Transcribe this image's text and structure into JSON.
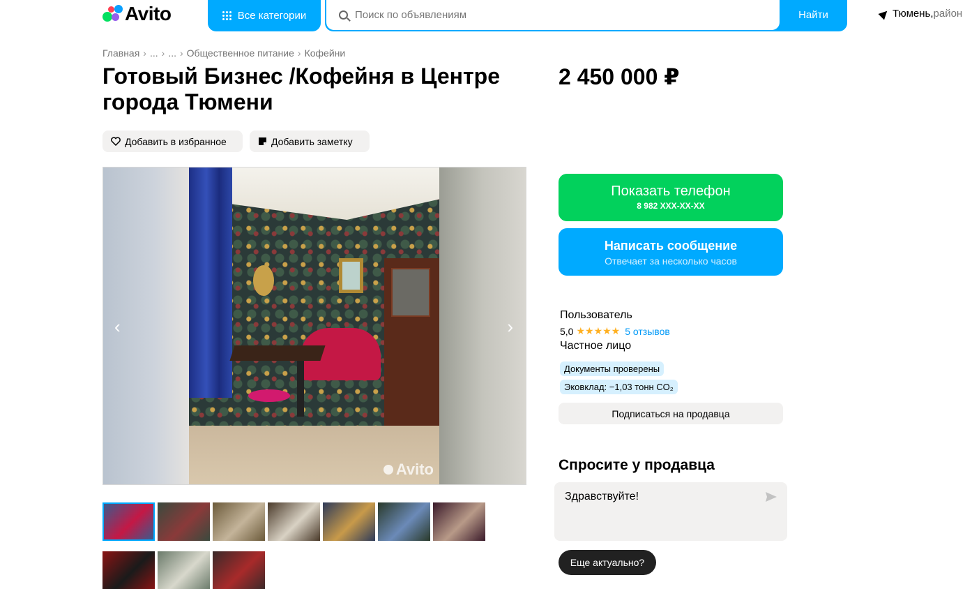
{
  "header": {
    "logo_text": "Avito",
    "categories_label": "Все категории",
    "search_placeholder": "Поиск по объявлениям",
    "search_button": "Найти",
    "location_city": "Тюмень,",
    "location_district": " район"
  },
  "breadcrumb": [
    "Главная",
    "...",
    "...",
    "Общественное питание",
    "Кофейни"
  ],
  "listing": {
    "title": "Готовый Бизнес /Кофейня в Центре города Тюмени",
    "price": "2 450 000 ₽",
    "favorite_label": "Добавить в избранное",
    "note_label": "Добавить заметку",
    "photo_watermark": "Avito",
    "nav_prev": "‹",
    "nav_next": "›"
  },
  "thumbnails": [
    {
      "name": "thumb-1",
      "colors": [
        "#3c5a8c",
        "#c41845"
      ]
    },
    {
      "name": "thumb-2",
      "colors": [
        "#3a4a3e",
        "#8a3a3a"
      ]
    },
    {
      "name": "thumb-3",
      "colors": [
        "#6b5a3a",
        "#c4b49a"
      ]
    },
    {
      "name": "thumb-4",
      "colors": [
        "#4a3a2a",
        "#d9d2c4"
      ]
    },
    {
      "name": "thumb-5",
      "colors": [
        "#2e3b5a",
        "#c89a4a"
      ]
    },
    {
      "name": "thumb-6",
      "colors": [
        "#2a3a2a",
        "#6b8ab8"
      ]
    },
    {
      "name": "thumb-7",
      "colors": [
        "#3a1a2a",
        "#b89a88"
      ]
    },
    {
      "name": "thumb-8",
      "colors": [
        "#8a1414",
        "#1a1a1a"
      ]
    },
    {
      "name": "thumb-9",
      "colors": [
        "#6a7a6a",
        "#d8d8cc"
      ]
    },
    {
      "name": "thumb-10",
      "colors": [
        "#3a2a2a",
        "#a82a2a"
      ]
    }
  ],
  "contact": {
    "phone_label": "Показать телефон",
    "phone_masked": "8 982 XXX-XX-XX",
    "message_label": "Написать сообщение",
    "message_sub": "Отвечает за несколько часов"
  },
  "seller": {
    "name": "Пользователь",
    "rating": "5,0",
    "stars": "★★★★★",
    "reviews": "5 отзывов",
    "type": "Частное лицо",
    "badge_docs": "Документы проверены",
    "badge_eco": "Эковклад: −1,03 тонн CO₂",
    "subscribe_label": "Подписаться на продавца"
  },
  "ask": {
    "title": "Спросите у продавца",
    "message_text": "Здравствуйте!",
    "quick_reply": "Еще актуально?"
  },
  "colors": {
    "brand_blue": "#00aaff",
    "brand_green": "#02d15c",
    "star": "#ffb021",
    "link": "#0099f7"
  }
}
